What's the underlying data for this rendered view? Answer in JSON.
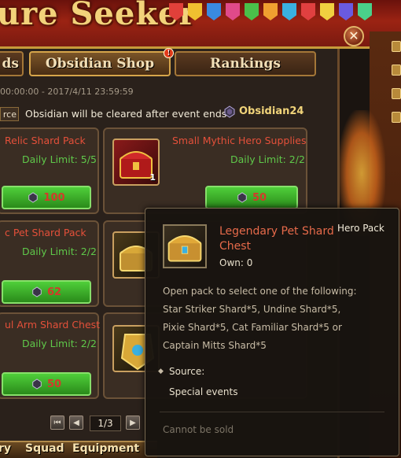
{
  "banner": {
    "title": "ure Seeker"
  },
  "colors": {
    "accent_gold": "#d6a54a",
    "title_red": "#e4503a",
    "limit_green": "#5fc84a",
    "buy_green": "#4fcf3a",
    "price_red": "#d33a2a"
  },
  "tabs": [
    {
      "label": "ds",
      "active": false
    },
    {
      "label": "Obsidian Shop",
      "active": true,
      "badge": "!"
    },
    {
      "label": "Rankings",
      "active": false
    }
  ],
  "event_time": "00:00:00 - 2017/4/11 23:59:59",
  "info": {
    "source_button": "rce",
    "note": "Obsidian will be cleared after event ends",
    "currency_icon": "obsidian-gem-icon",
    "currency_label": "Obsidian24"
  },
  "cards": [
    {
      "title": "Relic Shard Pack",
      "limit": "Daily Limit:  5/5",
      "price": "100"
    },
    {
      "title": "Small Mythic Hero Supplies",
      "limit": "Daily Limit:  2/2",
      "price": "50",
      "count": "1"
    },
    {
      "title": "c Pet Shard Pack",
      "limit": "Daily Limit:  2/2",
      "price": "62"
    },
    {
      "title": "ul Arm Shard Chest IV",
      "limit": "Daily Limit:  2/2",
      "price": "50"
    }
  ],
  "pager": {
    "page": "1/3",
    "first": "first-page-icon",
    "prev": "prev-page-icon",
    "next": "next-page-icon"
  },
  "bottom_nav": {
    "item1": "ry",
    "item2": "Squad",
    "item3": "Equipment"
  },
  "tooltip": {
    "name": "Legendary Pet Shard Chest",
    "type": "Hero Pack",
    "own": "Own: 0",
    "description_lines": [
      "Open pack to select one of the following:",
      "Star Striker Shard*5, Undine Shard*5,",
      "Pixie Shard*5, Cat Familiar Shard*5 or",
      "Captain Mitts Shard*5"
    ],
    "source_label": "Source:",
    "source_value": "Special events",
    "sell_note": "Cannot be sold"
  }
}
